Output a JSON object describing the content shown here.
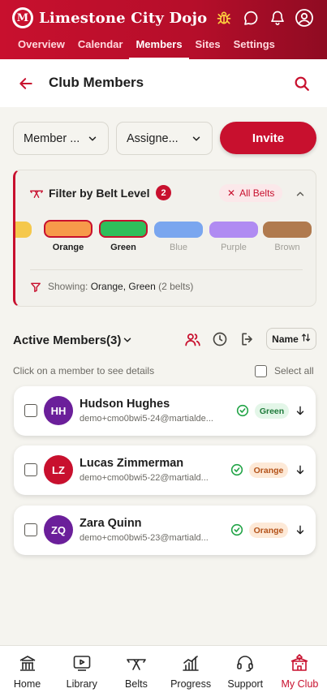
{
  "app": {
    "brand_initial": "M",
    "brand_name": "Limestone City Dojo"
  },
  "header": {
    "icons": [
      "bug-icon",
      "chat-bubble-icon",
      "bell-icon",
      "user-circle-icon"
    ],
    "tabs": [
      {
        "label": "Overview",
        "active": false
      },
      {
        "label": "Calendar",
        "active": false
      },
      {
        "label": "Members",
        "active": true
      },
      {
        "label": "Sites",
        "active": false
      },
      {
        "label": "Settings",
        "active": false
      }
    ]
  },
  "subheader": {
    "title": "Club Members"
  },
  "controls": {
    "member_type_select": "Member ...",
    "assignee_select": "Assigne...",
    "invite_label": "Invite"
  },
  "filter": {
    "title": "Filter by Belt Level",
    "count": "2",
    "clear_label": "All Belts",
    "belts": [
      {
        "label": "",
        "color": "#f5c84c",
        "selected": false
      },
      {
        "label": "Orange",
        "color": "#f79a4a",
        "selected": true
      },
      {
        "label": "Green",
        "color": "#2fbe5b",
        "selected": true
      },
      {
        "label": "Blue",
        "color": "#7aa6ef",
        "selected": false
      },
      {
        "label": "Purple",
        "color": "#b08bf2",
        "selected": false
      },
      {
        "label": "Brown",
        "color": "#b07a4e",
        "selected": false
      }
    ],
    "showing_prefix": "Showing: ",
    "showing_values": "Orange, Green",
    "showing_suffix": " (2 belts)"
  },
  "members_section": {
    "title": "Active Members(3)",
    "sort_label": "Name",
    "hint": "Click on a member to see details",
    "select_all": "Select all"
  },
  "members": [
    {
      "initials": "HH",
      "name": "Hudson Hughes",
      "email": "demo+cmo0bwi5-24@martialde...",
      "belt": "Green",
      "avatar_color": "#6b1f9a"
    },
    {
      "initials": "LZ",
      "name": "Lucas Zimmerman",
      "email": "demo+cmo0bwi5-22@martiald...",
      "belt": "Orange",
      "avatar_color": "#c8102e"
    },
    {
      "initials": "ZQ",
      "name": "Zara Quinn",
      "email": "demo+cmo0bwi5-23@martiald...",
      "belt": "Orange",
      "avatar_color": "#6b1f9a"
    }
  ],
  "bottom_nav": [
    {
      "label": "Home",
      "icon": "home-icon",
      "active": false
    },
    {
      "label": "Library",
      "icon": "play-video-icon",
      "active": false
    },
    {
      "label": "Belts",
      "icon": "belt-icon",
      "active": false
    },
    {
      "label": "Progress",
      "icon": "bar-chart-icon",
      "active": false
    },
    {
      "label": "Support",
      "icon": "headset-icon",
      "active": false
    },
    {
      "label": "My Club",
      "icon": "club-building-icon",
      "active": true
    }
  ],
  "colors": {
    "brand": "#c8102e",
    "background": "#f5f4ef"
  }
}
